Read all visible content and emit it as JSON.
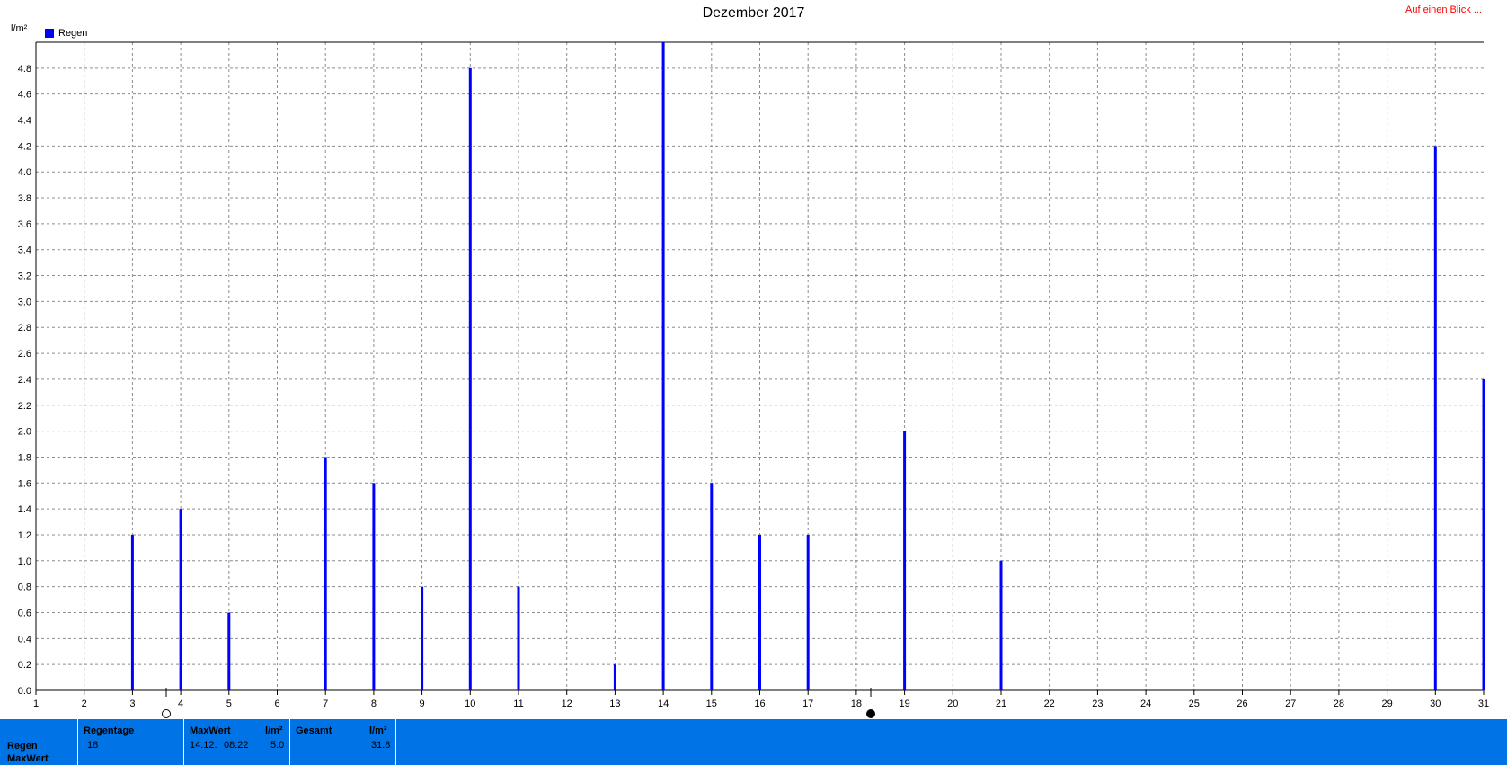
{
  "chart_data": {
    "type": "bar",
    "title": "Dezember 2017",
    "ylabel": "l/m²",
    "xlabel": "",
    "x_ticks": [
      1,
      2,
      3,
      4,
      5,
      6,
      7,
      8,
      9,
      10,
      11,
      12,
      13,
      14,
      15,
      16,
      17,
      18,
      19,
      20,
      21,
      22,
      23,
      24,
      25,
      26,
      27,
      28,
      29,
      30,
      31
    ],
    "y_ticks": [
      "0.0",
      "0.2",
      "0.4",
      "0.6",
      "0.8",
      "1.0",
      "1.2",
      "1.4",
      "1.6",
      "1.8",
      "2.0",
      "2.2",
      "2.4",
      "2.6",
      "2.8",
      "3.0",
      "3.2",
      "3.4",
      "3.6",
      "3.8",
      "4.0",
      "4.2",
      "4.4",
      "4.6",
      "4.8"
    ],
    "ylim": [
      0,
      5.0
    ],
    "xlim": [
      1,
      31
    ],
    "grid": true,
    "legend_position": "top-left",
    "series": [
      {
        "name": "Regen",
        "color": "#0000ff",
        "x": [
          3,
          4,
          5,
          7,
          8,
          9,
          10,
          11,
          13,
          14,
          15,
          16,
          17,
          19,
          21,
          30,
          31
        ],
        "values": [
          1.2,
          1.4,
          0.6,
          1.8,
          1.6,
          0.8,
          4.8,
          0.8,
          0.2,
          5.0,
          1.6,
          1.2,
          1.2,
          2.0,
          1.0,
          4.2,
          2.4
        ]
      }
    ],
    "moon_phases": [
      {
        "day": 3.7,
        "phase": "full-moon"
      },
      {
        "day": 18.3,
        "phase": "new-moon"
      }
    ]
  },
  "top_link": "Auf einen Blick ...",
  "footer": {
    "row_labels": [
      "Regen",
      "MaxWert"
    ],
    "regentage_header": "Regentage",
    "regentage_value": "18",
    "maxwert_header": "MaxWert",
    "maxwert_unit": "l/m²",
    "maxwert_date": "14.12.",
    "maxwert_time": "08:22",
    "maxwert_value": "5.0",
    "gesamt_header": "Gesamt",
    "gesamt_unit": "l/m²",
    "gesamt_value": "31.8",
    "background_color": "#0073e6"
  }
}
